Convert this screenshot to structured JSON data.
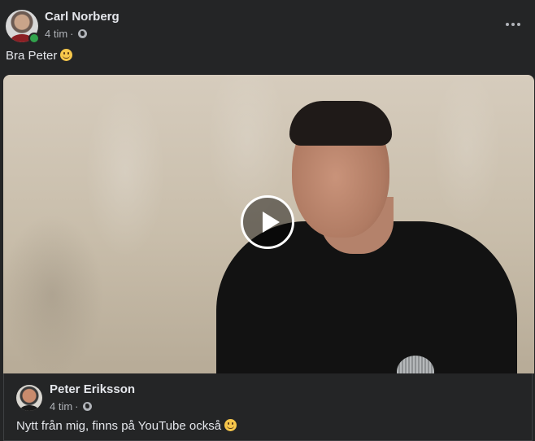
{
  "post": {
    "author": "Carl Norberg",
    "time": "4 tim",
    "separator": "·",
    "privacy_icon": "globe-icon",
    "caption": "Bra Peter",
    "caption_emoji": "smile-emoji",
    "online_status_color": "#31a24c"
  },
  "video": {
    "play_icon": "play-icon"
  },
  "shared_post": {
    "author": "Peter Eriksson",
    "time": "4 tim",
    "separator": "·",
    "privacy_icon": "globe-icon",
    "text": "Nytt från mig, finns på YouTube också",
    "text_emoji": "smile-emoji"
  },
  "menu": {
    "more_icon": "more-options-icon"
  },
  "colors": {
    "background": "#242526",
    "text_primary": "#e4e6eb",
    "text_secondary": "#b0b3b8"
  }
}
